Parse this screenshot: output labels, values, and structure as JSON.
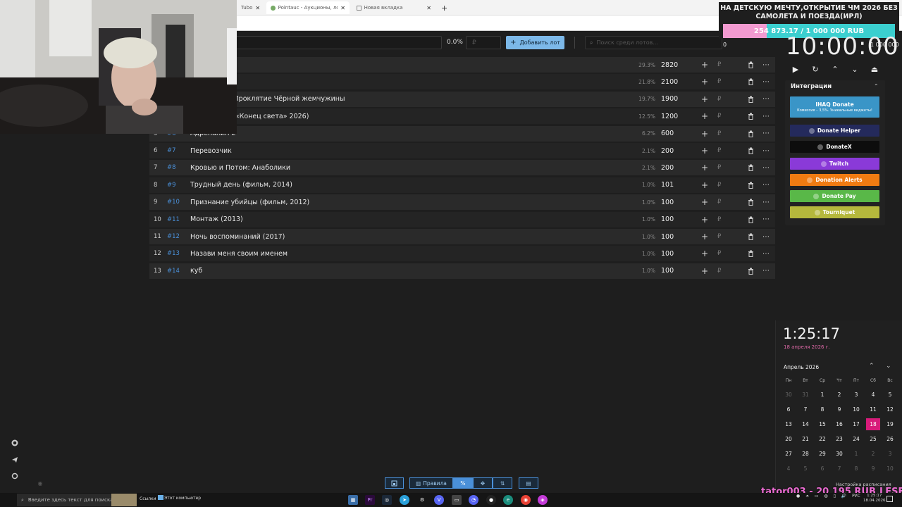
{
  "browser": {
    "tabs": [
      {
        "label": "Tubo"
      },
      {
        "label": "Pointauc - Аукционы, лотереи и"
      },
      {
        "label": "Новая вкладка"
      }
    ]
  },
  "toolbar": {
    "percent": "0.0%",
    "amount_placeholder": "₽",
    "add_lot_label": "Добавить лот",
    "search_placeholder": "Поиск среди лотов..."
  },
  "lots": [
    {
      "num": "",
      "id": "",
      "name": "",
      "pct": "29.3%",
      "amount": "2820"
    },
    {
      "num": "",
      "id": "",
      "name": "",
      "pct": "21.8%",
      "amount": "2100"
    },
    {
      "num": "",
      "id": "",
      "name": "ского моря: Проклятие Чёрной жемчужины",
      "pct": "19.7%",
      "amount": "1900"
    },
    {
      "num": "",
      "id": "",
      "name": "рия (Проект «Конец света» 2026)",
      "pct": "12.5%",
      "amount": "1200"
    },
    {
      "num": "5",
      "id": "#6",
      "name": "Адреналин 2",
      "pct": "6.2%",
      "amount": "600"
    },
    {
      "num": "6",
      "id": "#7",
      "name": "Перевозчик",
      "pct": "2.1%",
      "amount": "200"
    },
    {
      "num": "7",
      "id": "#8",
      "name": "Кровью и Потом: Анаболики",
      "pct": "2.1%",
      "amount": "200"
    },
    {
      "num": "8",
      "id": "#9",
      "name": "Трудный день (фильм, 2014)",
      "pct": "1.0%",
      "amount": "101"
    },
    {
      "num": "9",
      "id": "#10",
      "name": "Признание убийцы (фильм, 2012)",
      "pct": "1.0%",
      "amount": "100"
    },
    {
      "num": "10",
      "id": "#11",
      "name": "Монтаж (2013)",
      "pct": "1.0%",
      "amount": "100"
    },
    {
      "num": "11",
      "id": "#12",
      "name": "Ночь воспоминаний (2017)",
      "pct": "1.0%",
      "amount": "100"
    },
    {
      "num": "12",
      "id": "#13",
      "name": "Назави меня своим именем",
      "pct": "1.0%",
      "amount": "100"
    },
    {
      "num": "13",
      "id": "#14",
      "name": "куб",
      "pct": "1.0%",
      "amount": "100"
    }
  ],
  "currency_symbol": "₽",
  "bottombar": {
    "rules_label": "Правила",
    "percent_label": "%"
  },
  "goal": {
    "title": "НА ДЕТСКУЮ МЕЧТУ,ОТКРЫТИЕ ЧМ 2026 БЕЗ САМОЛЕТА И ПОЕЗДА(ИРЛ)",
    "progress_text": "254 873.17 / 1 000 000 RUB",
    "progress_fraction": 0.2549,
    "min": "0",
    "max": "1 000 000"
  },
  "timer": {
    "value": "10:00:00"
  },
  "integrations": {
    "title": "Интеграции",
    "items": [
      {
        "label": "IHAQ Donate",
        "sub": "Комиссия – 3,5%. Уникальные виджеты!",
        "color": "#3a95c7"
      },
      {
        "label": "Donate Helper",
        "color": "#242a5c"
      },
      {
        "label": "DonateX",
        "color": "#0d0d0d"
      },
      {
        "label": "Twitch",
        "color": "#8a3ad8"
      },
      {
        "label": "Donation Alerts",
        "color": "#f07b12"
      },
      {
        "label": "Donate Pay",
        "color": "#59b848"
      },
      {
        "label": "Tourniquet",
        "color": "#b5b83c"
      }
    ]
  },
  "clock": {
    "time": "1:25:17",
    "date": "18 апреля 2026 г.",
    "month": "Апрель 2026",
    "weekdays": [
      "Пн",
      "Вт",
      "Ср",
      "Чт",
      "Пт",
      "Сб",
      "Вс"
    ],
    "weeks": [
      [
        "30",
        "31",
        "1",
        "2",
        "3",
        "4",
        "5"
      ],
      [
        "6",
        "7",
        "8",
        "9",
        "10",
        "11",
        "12"
      ],
      [
        "13",
        "14",
        "15",
        "16",
        "17",
        "18",
        "19"
      ],
      [
        "20",
        "21",
        "22",
        "23",
        "24",
        "25",
        "26"
      ],
      [
        "27",
        "28",
        "29",
        "30",
        "1",
        "2",
        "3"
      ],
      [
        "4",
        "5",
        "6",
        "7",
        "8",
        "9",
        "10"
      ]
    ],
    "schedule_label": "Настройка расписания"
  },
  "donation_ticker": {
    "text": "tator003 - 20 195 RUB",
    "text2": "LESE"
  },
  "taskbar": {
    "search_placeholder": "Введите здесь текст для поиска",
    "links_label": "Ссылки",
    "computer_label": "Этот компьютер",
    "lang": "РУС",
    "time": "1:25:17",
    "date": "18.04.2026"
  }
}
